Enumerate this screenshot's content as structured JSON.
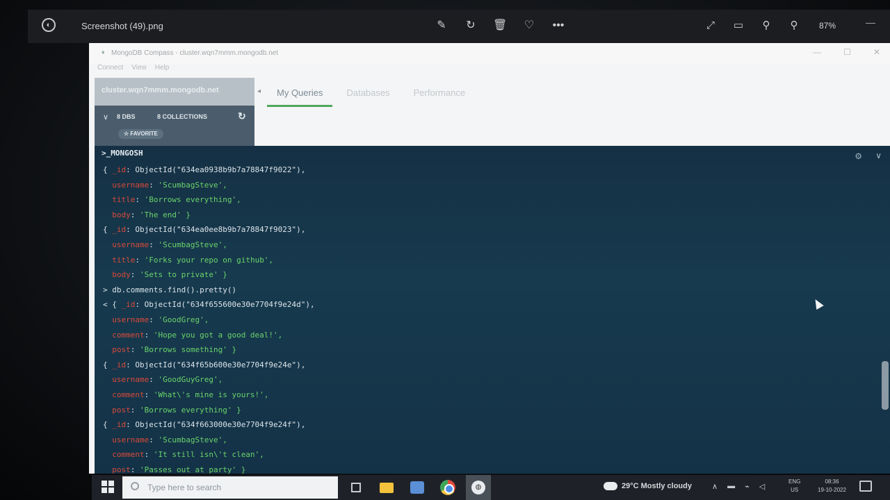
{
  "viewer": {
    "file_name": "Screenshot (49).png",
    "zoom": "87%",
    "icons": [
      "edit-icon",
      "rotate-icon",
      "delete-icon",
      "favorite-icon",
      "more-icon"
    ],
    "right_icons": [
      "fullscreen-icon",
      "info-icon",
      "zoom-out-icon",
      "zoom-in-icon"
    ]
  },
  "compass": {
    "window_title": "MongoDB Compass - cluster.wqn7mmm.mongodb.net",
    "menu": [
      "Connect",
      "View",
      "Help"
    ],
    "sidebar": {
      "connection": "cluster.wqn7mmm.mongodb.net",
      "dbs_label": "8 DBS",
      "collections_label": "8 COLLECTIONS",
      "favorite_label": "☆ FAVORITE"
    },
    "tabs": [
      {
        "label": "My Queries",
        "active": true
      },
      {
        "label": "Databases",
        "active": false
      },
      {
        "label": "Performance",
        "active": false
      }
    ]
  },
  "shell": {
    "title": ">_MONGOSH",
    "lines": [
      {
        "indent": "{ ",
        "key": "_id",
        "value": "ObjectId(\"634ea0938b9b7a78847f9022\"),",
        "value_class": "p"
      },
      {
        "indent": "  ",
        "key": "username",
        "value": "'ScumbagSteve',",
        "value_class": "s"
      },
      {
        "indent": "  ",
        "key": "title",
        "value": "'Borrows everything',",
        "value_class": "s"
      },
      {
        "indent": "  ",
        "key": "body",
        "value": "'The end' }",
        "value_class": "s"
      },
      {
        "indent": "{ ",
        "key": "_id",
        "value": "ObjectId(\"634ea0ee8b9b7a78847f9023\"),",
        "value_class": "p"
      },
      {
        "indent": "  ",
        "key": "username",
        "value": "'ScumbagSteve',",
        "value_class": "s"
      },
      {
        "indent": "  ",
        "key": "title",
        "value": "'Forks your repo on github',",
        "value_class": "s"
      },
      {
        "indent": "  ",
        "key": "body",
        "value": "'Sets to private' }",
        "value_class": "s"
      },
      {
        "indent": "> ",
        "key": "",
        "value": "db.comments.find().pretty()",
        "value_class": "p"
      },
      {
        "indent": "< { ",
        "key": "_id",
        "value": "ObjectId(\"634f655600e30e7704f9e24d\"),",
        "value_class": "p"
      },
      {
        "indent": "  ",
        "key": "username",
        "value": "'GoodGreg',",
        "value_class": "s"
      },
      {
        "indent": "  ",
        "key": "comment",
        "value": "'Hope you got a good deal!',",
        "value_class": "s"
      },
      {
        "indent": "  ",
        "key": "post",
        "value": "'Borrows something' }",
        "value_class": "s"
      },
      {
        "indent": "{ ",
        "key": "_id",
        "value": "ObjectId(\"634f65b600e30e7704f9e24e\"),",
        "value_class": "p"
      },
      {
        "indent": "  ",
        "key": "username",
        "value": "'GoodGuyGreg',",
        "value_class": "s"
      },
      {
        "indent": "  ",
        "key": "comment",
        "value": "'What\\'s mine is yours!',",
        "value_class": "s"
      },
      {
        "indent": "  ",
        "key": "post",
        "value": "'Borrows everything' }",
        "value_class": "s"
      },
      {
        "indent": "{ ",
        "key": "_id",
        "value": "ObjectId(\"634f663000e30e7704f9e24f\"),",
        "value_class": "p"
      },
      {
        "indent": "  ",
        "key": "username",
        "value": "'ScumbagSteve',",
        "value_class": "s"
      },
      {
        "indent": "  ",
        "key": "comment",
        "value": "'It still isn\\'t clean',",
        "value_class": "s"
      },
      {
        "indent": "  ",
        "key": "post",
        "value": "'Passes out at party' }",
        "value_class": "s"
      }
    ]
  },
  "taskbar": {
    "search_placeholder": "Type here to search",
    "weather": "29°C  Mostly cloudy",
    "lang": "ENG",
    "region": "US",
    "time": "08:36",
    "date": "19-10-2022"
  }
}
